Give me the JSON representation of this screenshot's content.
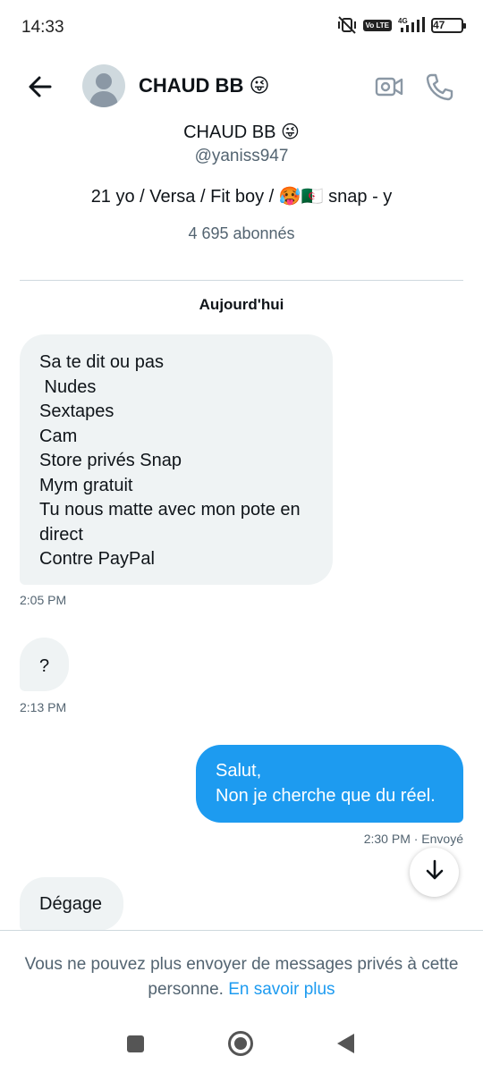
{
  "status_bar": {
    "time": "14:33",
    "network": "4G",
    "volte": "Vo LTE",
    "battery": "47"
  },
  "header": {
    "back_icon": "arrow-left-icon",
    "avatar_icon": "default-avatar-icon",
    "title": "CHAUD BB 😜",
    "video_icon": "video-call-icon",
    "phone_icon": "phone-call-icon"
  },
  "profile": {
    "name": "CHAUD BB 😜",
    "handle": "@yaniss947",
    "bio": "21 yo / Versa / Fit boy / 🥵🇩🇿 snap - y",
    "followers": "4 695 abonnés"
  },
  "day_label": "Aujourd'hui",
  "messages": [
    {
      "direction": "incoming",
      "lines": [
        "Sa te dit ou pas",
        " Nudes",
        "Sextapes",
        "Cam",
        "Store privés Snap",
        "Mym gratuit",
        "Tu nous matte avec mon pote en",
        "direct",
        "Contre PayPal"
      ],
      "time": "2:05 PM"
    },
    {
      "direction": "incoming",
      "lines": [
        "?"
      ],
      "time": "2:13 PM"
    },
    {
      "direction": "outgoing",
      "lines": [
        "Salut,",
        "Non je cherche que du réel."
      ],
      "time": "2:30 PM · Envoyé"
    },
    {
      "direction": "incoming",
      "lines": [
        "Dégage"
      ]
    }
  ],
  "scroll_button_icon": "arrow-down-icon",
  "footer": {
    "notice": "Vous ne pouvez plus envoyer de messages privés à cette personne.",
    "link": "En savoir plus"
  },
  "nav_bar": {
    "recents_icon": "recents-square-icon",
    "home_icon": "home-circle-icon",
    "back_icon": "back-triangle-icon"
  },
  "colors": {
    "accent": "#1d9bf0",
    "incoming_bubble": "#eff3f4",
    "secondary_text": "#536471"
  }
}
